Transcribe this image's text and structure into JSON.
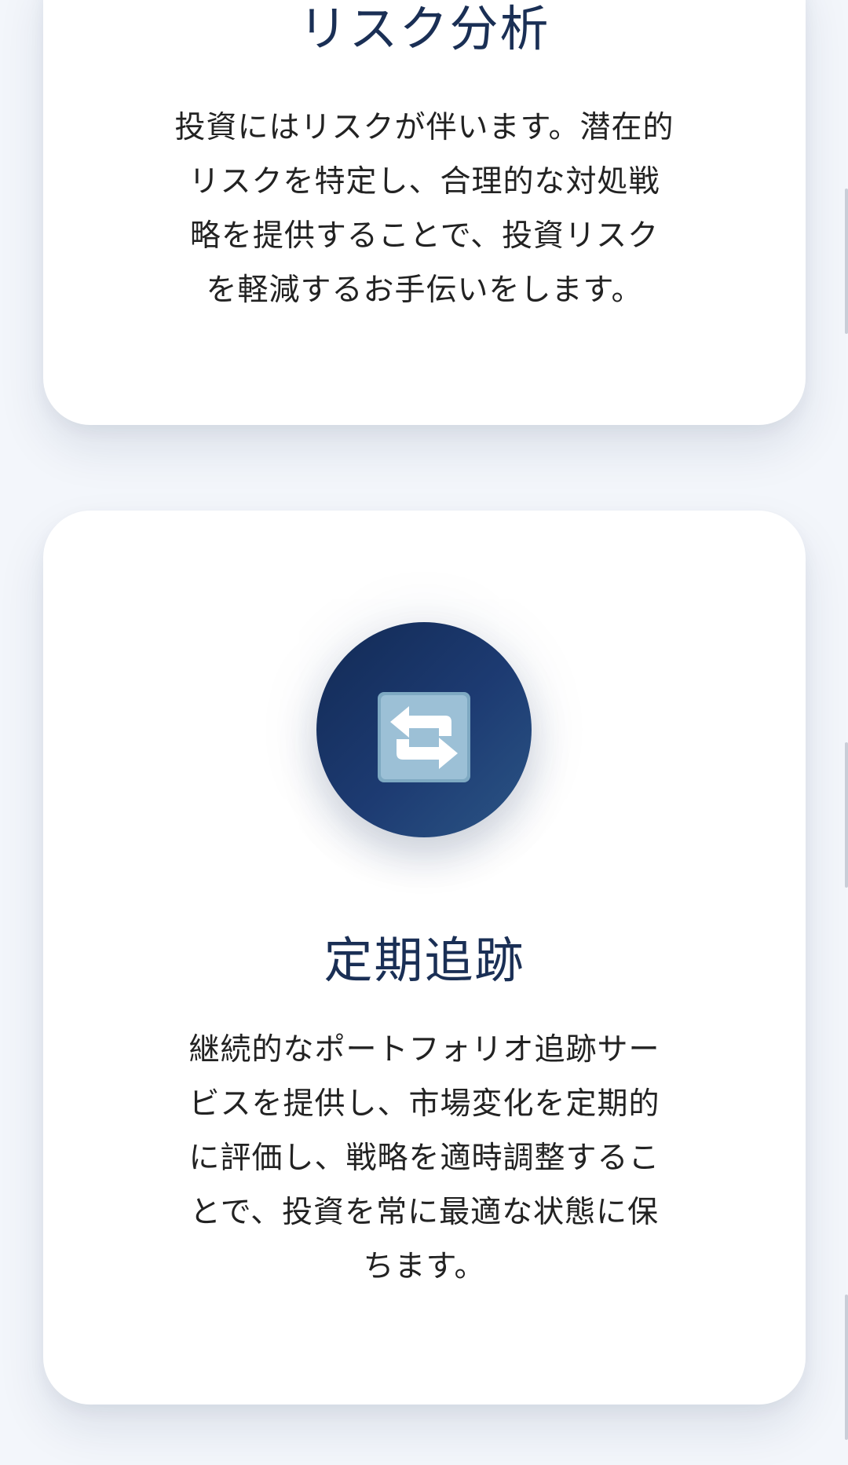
{
  "cards": [
    {
      "title": "リスク分析",
      "description_lines": [
        "投資にはリスクが伴います。潜在的",
        "リスクを特定し、合理的な対処戦",
        "略を提供することで、投資リスク",
        "を軽減するお手伝いをします。"
      ]
    },
    {
      "icon": "repeat-arrows-icon",
      "title": "定期追跡",
      "description_lines": [
        "継続的なポートフォリオ追跡サー",
        "ビスを提供し、市場変化を定期的",
        "に評価し、戦略を適時調整するこ",
        "とで、投資を常に最適な状態に保",
        "ちます。"
      ]
    }
  ],
  "colors": {
    "page_background": "#f3f6fb",
    "card_background": "#ffffff",
    "title_color": "#1a2f55",
    "icon_circle_dark": "#122a55",
    "icon_circle_light": "#2b5585",
    "icon_tile": "#8fb3c9"
  }
}
